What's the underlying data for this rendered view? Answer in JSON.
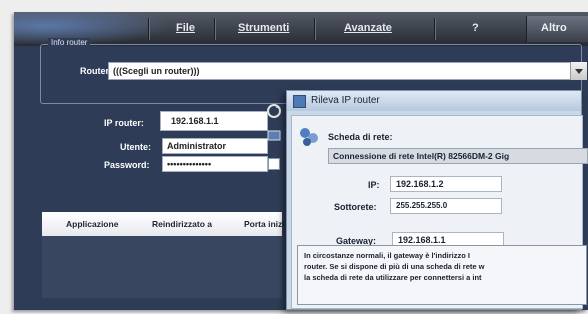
{
  "menu": {
    "items": [
      "File",
      "Strumenti",
      "Avanzate",
      "?"
    ],
    "altro": "Altro"
  },
  "info_router": {
    "group_label": "Info router",
    "router_label": "Router:",
    "router_value": "(((Scegli un router)))",
    "ip_label": "IP router:",
    "ip_value": "192.168.1.1",
    "user_label": "Utente:",
    "user_value": "Administrator",
    "password_label": "Password:",
    "password_value": "••••••••••••••"
  },
  "tabs": [
    "Applicazione",
    "Reindirizzato a",
    "Porta inizi"
  ],
  "dialog": {
    "title": "Rileva IP router",
    "adapter_label": "Scheda di rete:",
    "adapter_value": "Connessione di rete Intel(R) 82566DM-2 Gig",
    "ip_label": "IP:",
    "ip_value": "192.168.1.2",
    "subnet_label": "Sottorete:",
    "subnet_value": "255.255.255.0",
    "gateway_label": "Gateway:",
    "gateway_value": "192.168.1.1",
    "note_lines": [
      "In circostanze normali, il gateway è l'indirizzo I",
      "router. Se si dispone di più di una scheda di rete w",
      "la scheda di rete da utilizzare per connettersi a int"
    ]
  },
  "colors": {
    "background": "#2e3c57",
    "titlebar": "#3a3f49",
    "dialog": "#c9d8e8"
  }
}
